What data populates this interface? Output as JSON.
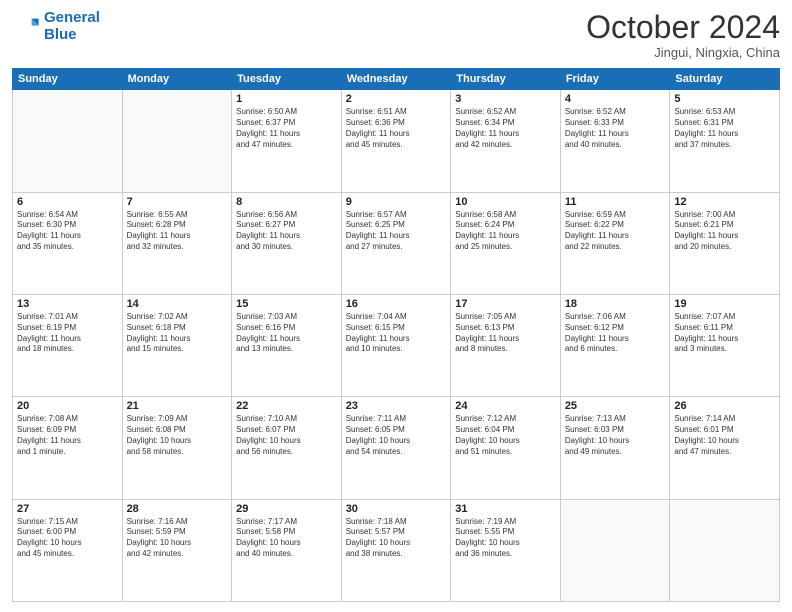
{
  "logo": {
    "line1": "General",
    "line2": "Blue"
  },
  "title": "October 2024",
  "location": "Jingui, Ningxia, China",
  "days_header": [
    "Sunday",
    "Monday",
    "Tuesday",
    "Wednesday",
    "Thursday",
    "Friday",
    "Saturday"
  ],
  "weeks": [
    [
      {
        "day": "",
        "info": ""
      },
      {
        "day": "",
        "info": ""
      },
      {
        "day": "1",
        "info": "Sunrise: 6:50 AM\nSunset: 6:37 PM\nDaylight: 11 hours\nand 47 minutes."
      },
      {
        "day": "2",
        "info": "Sunrise: 6:51 AM\nSunset: 6:36 PM\nDaylight: 11 hours\nand 45 minutes."
      },
      {
        "day": "3",
        "info": "Sunrise: 6:52 AM\nSunset: 6:34 PM\nDaylight: 11 hours\nand 42 minutes."
      },
      {
        "day": "4",
        "info": "Sunrise: 6:52 AM\nSunset: 6:33 PM\nDaylight: 11 hours\nand 40 minutes."
      },
      {
        "day": "5",
        "info": "Sunrise: 6:53 AM\nSunset: 6:31 PM\nDaylight: 11 hours\nand 37 minutes."
      }
    ],
    [
      {
        "day": "6",
        "info": "Sunrise: 6:54 AM\nSunset: 6:30 PM\nDaylight: 11 hours\nand 35 minutes."
      },
      {
        "day": "7",
        "info": "Sunrise: 6:55 AM\nSunset: 6:28 PM\nDaylight: 11 hours\nand 32 minutes."
      },
      {
        "day": "8",
        "info": "Sunrise: 6:56 AM\nSunset: 6:27 PM\nDaylight: 11 hours\nand 30 minutes."
      },
      {
        "day": "9",
        "info": "Sunrise: 6:57 AM\nSunset: 6:25 PM\nDaylight: 11 hours\nand 27 minutes."
      },
      {
        "day": "10",
        "info": "Sunrise: 6:58 AM\nSunset: 6:24 PM\nDaylight: 11 hours\nand 25 minutes."
      },
      {
        "day": "11",
        "info": "Sunrise: 6:59 AM\nSunset: 6:22 PM\nDaylight: 11 hours\nand 22 minutes."
      },
      {
        "day": "12",
        "info": "Sunrise: 7:00 AM\nSunset: 6:21 PM\nDaylight: 11 hours\nand 20 minutes."
      }
    ],
    [
      {
        "day": "13",
        "info": "Sunrise: 7:01 AM\nSunset: 6:19 PM\nDaylight: 11 hours\nand 18 minutes."
      },
      {
        "day": "14",
        "info": "Sunrise: 7:02 AM\nSunset: 6:18 PM\nDaylight: 11 hours\nand 15 minutes."
      },
      {
        "day": "15",
        "info": "Sunrise: 7:03 AM\nSunset: 6:16 PM\nDaylight: 11 hours\nand 13 minutes."
      },
      {
        "day": "16",
        "info": "Sunrise: 7:04 AM\nSunset: 6:15 PM\nDaylight: 11 hours\nand 10 minutes."
      },
      {
        "day": "17",
        "info": "Sunrise: 7:05 AM\nSunset: 6:13 PM\nDaylight: 11 hours\nand 8 minutes."
      },
      {
        "day": "18",
        "info": "Sunrise: 7:06 AM\nSunset: 6:12 PM\nDaylight: 11 hours\nand 6 minutes."
      },
      {
        "day": "19",
        "info": "Sunrise: 7:07 AM\nSunset: 6:11 PM\nDaylight: 11 hours\nand 3 minutes."
      }
    ],
    [
      {
        "day": "20",
        "info": "Sunrise: 7:08 AM\nSunset: 6:09 PM\nDaylight: 11 hours\nand 1 minute."
      },
      {
        "day": "21",
        "info": "Sunrise: 7:09 AM\nSunset: 6:08 PM\nDaylight: 10 hours\nand 58 minutes."
      },
      {
        "day": "22",
        "info": "Sunrise: 7:10 AM\nSunset: 6:07 PM\nDaylight: 10 hours\nand 56 minutes."
      },
      {
        "day": "23",
        "info": "Sunrise: 7:11 AM\nSunset: 6:05 PM\nDaylight: 10 hours\nand 54 minutes."
      },
      {
        "day": "24",
        "info": "Sunrise: 7:12 AM\nSunset: 6:04 PM\nDaylight: 10 hours\nand 51 minutes."
      },
      {
        "day": "25",
        "info": "Sunrise: 7:13 AM\nSunset: 6:03 PM\nDaylight: 10 hours\nand 49 minutes."
      },
      {
        "day": "26",
        "info": "Sunrise: 7:14 AM\nSunset: 6:01 PM\nDaylight: 10 hours\nand 47 minutes."
      }
    ],
    [
      {
        "day": "27",
        "info": "Sunrise: 7:15 AM\nSunset: 6:00 PM\nDaylight: 10 hours\nand 45 minutes."
      },
      {
        "day": "28",
        "info": "Sunrise: 7:16 AM\nSunset: 5:59 PM\nDaylight: 10 hours\nand 42 minutes."
      },
      {
        "day": "29",
        "info": "Sunrise: 7:17 AM\nSunset: 5:58 PM\nDaylight: 10 hours\nand 40 minutes."
      },
      {
        "day": "30",
        "info": "Sunrise: 7:18 AM\nSunset: 5:57 PM\nDaylight: 10 hours\nand 38 minutes."
      },
      {
        "day": "31",
        "info": "Sunrise: 7:19 AM\nSunset: 5:55 PM\nDaylight: 10 hours\nand 36 minutes."
      },
      {
        "day": "",
        "info": ""
      },
      {
        "day": "",
        "info": ""
      }
    ]
  ]
}
